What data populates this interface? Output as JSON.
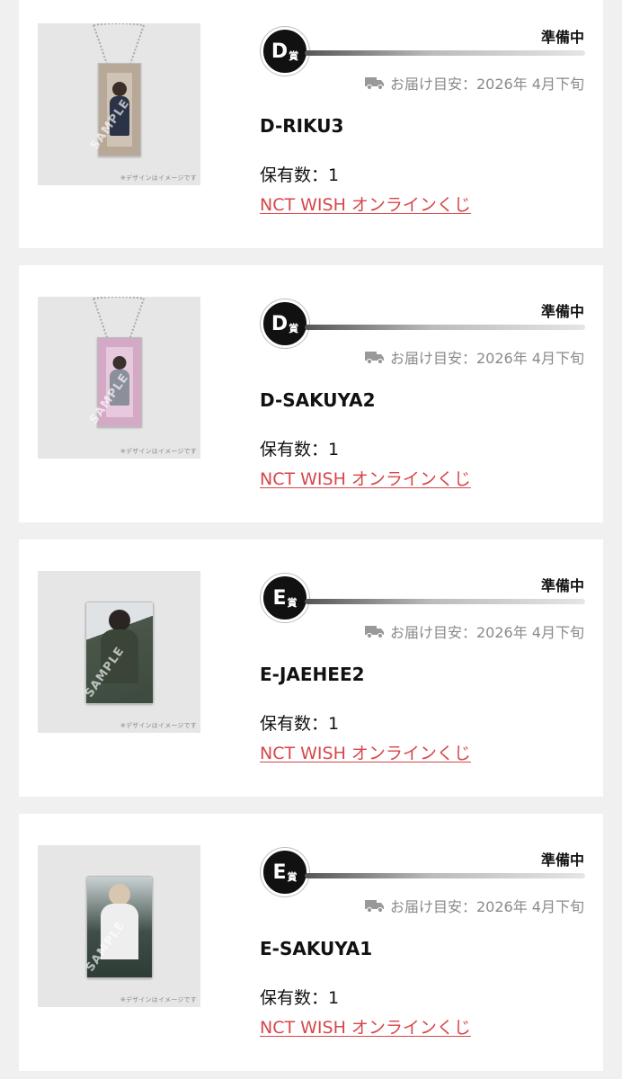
{
  "items": [
    {
      "grade": "D",
      "prize_suffix": "賞",
      "status": "準備中",
      "delivery_text": "お届け目安：2026年 4月下旬",
      "name": "D-RIKU3",
      "quantity": "保有数：1",
      "lottery_link": "NCT WISH オンラインくじ",
      "image_caption": "※デザインはイメージです",
      "image_type": "acrylic-keychain",
      "plate_color": "#b8a898",
      "watermark": "SAMPLE"
    },
    {
      "grade": "D",
      "prize_suffix": "賞",
      "status": "準備中",
      "delivery_text": "お届け目安：2026年 4月下旬",
      "name": "D-SAKUYA2",
      "quantity": "保有数：1",
      "lottery_link": "NCT WISH オンラインくじ",
      "image_caption": "※デザインはイメージです",
      "image_type": "acrylic-keychain",
      "plate_color": "#d4a9c6",
      "watermark": "SAMPLE"
    },
    {
      "grade": "E",
      "prize_suffix": "賞",
      "status": "準備中",
      "delivery_text": "お届け目安：2026年 4月下旬",
      "name": "E-JAEHEE2",
      "quantity": "保有数：1",
      "lottery_link": "NCT WISH オンラインくじ",
      "image_caption": "※デザインはイメージです",
      "image_type": "photo-card",
      "plate_color": "#5f6a58",
      "watermark": "SAMPLE"
    },
    {
      "grade": "E",
      "prize_suffix": "賞",
      "status": "準備中",
      "delivery_text": "お届け目安：2026年 4月下旬",
      "name": "E-SAKUYA1",
      "quantity": "保有数：1",
      "lottery_link": "NCT WISH オンラインくじ",
      "image_caption": "※デザインはイメージです",
      "image_type": "photo-card",
      "plate_color": "#4a5a52",
      "watermark": "SAMPLE"
    }
  ],
  "colors": {
    "link": "#d6474a",
    "delivery": "#8a8a8a",
    "badge": "#111111",
    "background": "#f0f0f0"
  },
  "icons": {
    "delivery": "truck-icon"
  }
}
